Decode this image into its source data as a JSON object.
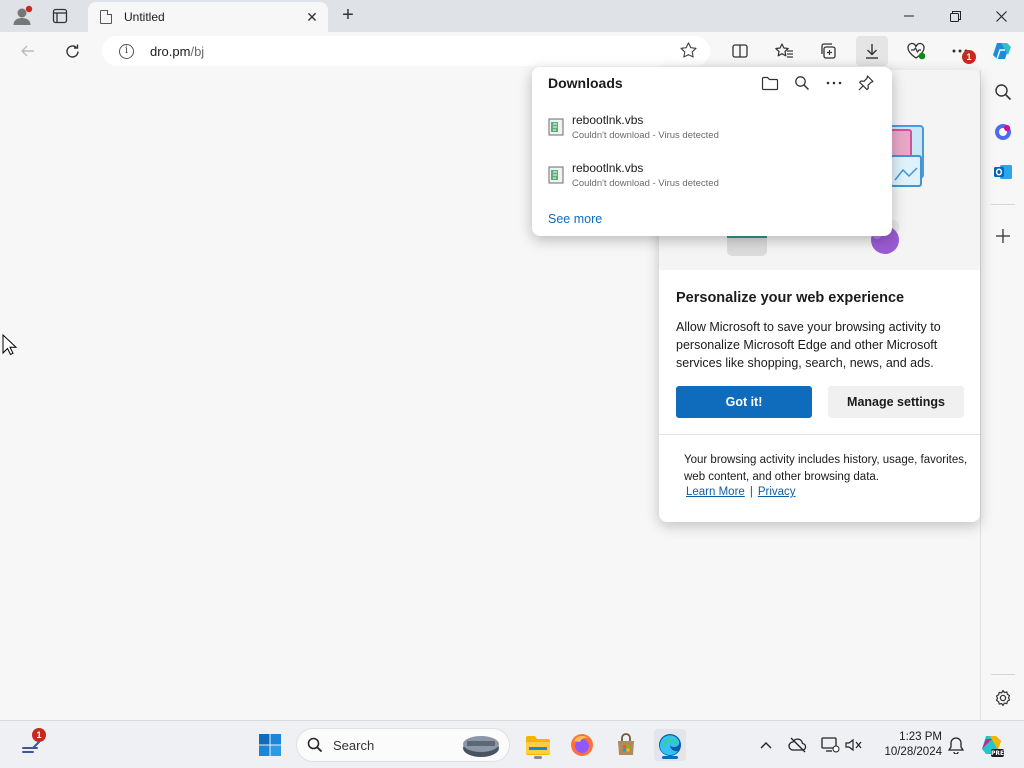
{
  "tab": {
    "title": "Untitled"
  },
  "address": {
    "domain": "dro.pm",
    "path": "/bj"
  },
  "toolbar": {
    "icons": [
      "split-screen-icon",
      "favorites-icon",
      "collections-icon",
      "downloads-icon",
      "browser-essentials-icon",
      "more-icon",
      "copilot-icon"
    ],
    "notification_badge": "1"
  },
  "downloads": {
    "title": "Downloads",
    "items": [
      {
        "name": "rebootlnk.vbs",
        "status": "Couldn't download - Virus detected"
      },
      {
        "name": "rebootlnk.vbs",
        "status": "Couldn't download - Virus detected"
      }
    ],
    "see_more": "See more"
  },
  "personalize": {
    "title": "Personalize your web experience",
    "body": "Allow Microsoft to save your browsing activity to personalize Microsoft Edge and other Microsoft services like shopping, search, news, and ads.",
    "primary_button": "Got it!",
    "secondary_button": "Manage settings",
    "footnote": "Your browsing activity includes history, usage, favorites, web content, and other browsing data.",
    "learn_more": "Learn More",
    "separator": "|",
    "privacy": "Privacy"
  },
  "taskbar": {
    "widgets_badge": "1",
    "search_label": "Search",
    "time": "1:23 PM",
    "date": "10/28/2024"
  },
  "colors": {
    "accent": "#0f6cbd",
    "badge": "#c42b1c"
  }
}
